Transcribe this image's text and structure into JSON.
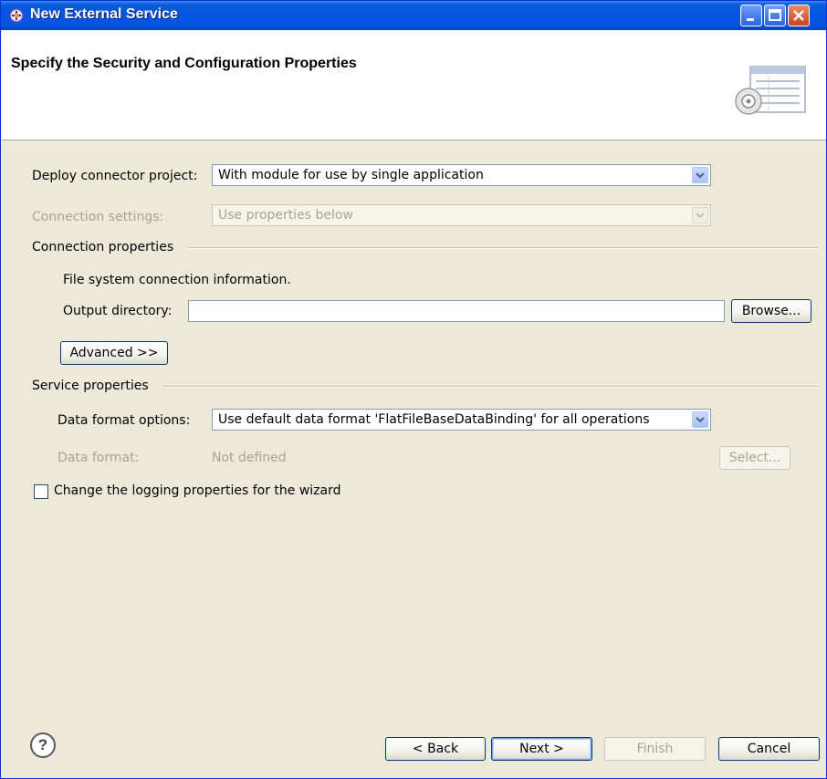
{
  "window": {
    "title": "New External Service"
  },
  "header": {
    "title": "Specify the Security and Configuration Properties"
  },
  "deploy": {
    "label": "Deploy connector project:",
    "value": "With module for use by single application"
  },
  "connection_settings": {
    "label": "Connection settings:",
    "value": "Use properties below"
  },
  "connection_properties": {
    "group_label": "Connection properties",
    "info": "File system connection information.",
    "output_label": "Output directory:",
    "output_value": "",
    "browse_label": "Browse...",
    "advanced_label": "Advanced >>"
  },
  "service_properties": {
    "group_label": "Service properties",
    "data_format_options_label": "Data format options:",
    "data_format_options_value": "Use default data format 'FlatFileBaseDataBinding' for all operations",
    "data_format_label": "Data format:",
    "data_format_value": "Not defined",
    "select_label": "Select..."
  },
  "logging": {
    "label": "Change the logging properties for the wizard",
    "checked": false
  },
  "footer": {
    "help_glyph": "?",
    "back_label": "< Back",
    "next_label": "Next >",
    "finish_label": "Finish",
    "cancel_label": "Cancel"
  },
  "icons": [
    "app-icon",
    "minimize-icon",
    "maximize-icon",
    "close-icon",
    "wizard-banner-icon",
    "dropdown-arrow-icon",
    "help-icon"
  ]
}
